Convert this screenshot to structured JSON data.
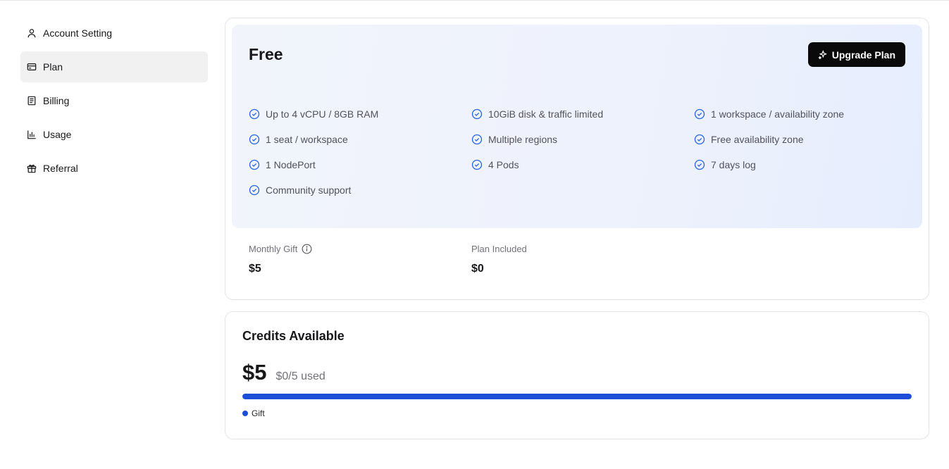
{
  "sidebar": {
    "items": [
      {
        "label": "Account Setting",
        "icon": "user-icon"
      },
      {
        "label": "Plan",
        "icon": "credit-card-icon",
        "active": true
      },
      {
        "label": "Billing",
        "icon": "receipt-icon"
      },
      {
        "label": "Usage",
        "icon": "bar-chart-icon"
      },
      {
        "label": "Referral",
        "icon": "gift-icon"
      }
    ]
  },
  "plan": {
    "name": "Free",
    "upgrade_label": "Upgrade Plan",
    "features": [
      "Up to 4 vCPU / 8GB RAM",
      "10GiB disk & traffic limited",
      "1 workspace / availability zone",
      "1 seat / workspace",
      "Multiple regions",
      "Free availability zone",
      "1 NodePort",
      "4 Pods",
      "7 days log",
      "Community support"
    ],
    "monthly_gift_label": "Monthly Gift",
    "monthly_gift_value": "$5",
    "plan_included_label": "Plan Included",
    "plan_included_value": "$0"
  },
  "credits": {
    "title": "Credits Available",
    "amount": "$5",
    "used_text": "$0/5 used",
    "progress_fraction": 1.0,
    "legend_label": "Gift"
  },
  "colors": {
    "accent": "#1d4ed8",
    "check": "#2563eb",
    "button_bg": "#0a0a0a"
  }
}
